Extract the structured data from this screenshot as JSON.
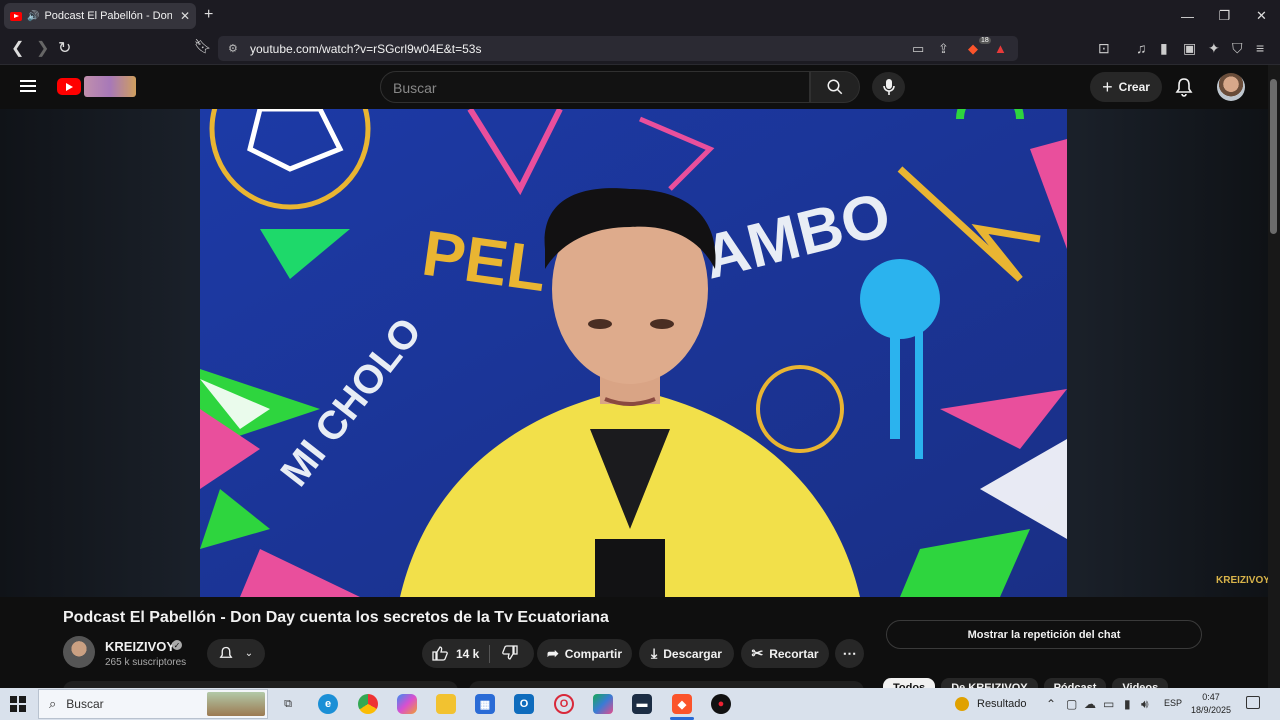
{
  "browser": {
    "tab_title": "Podcast El Pabellón - Don Day",
    "tab_close": "✕",
    "new_tab": "+",
    "url": "youtube.com/watch?v=rSGcrl9w04E&t=53s",
    "shield_count": "18"
  },
  "youtube": {
    "search_placeholder": "Buscar",
    "create_label": "Crear",
    "video": {
      "title": "Podcast El Pabellón - Don Day cuenta los secretos de la Tv Ecuatoriana",
      "watermark": "KREIZIVOY",
      "wall_texts": [
        "PEL",
        "AMBO",
        "MI CHOLO"
      ]
    },
    "channel": {
      "name": "KREIZIVOY",
      "subscribers": "265 k suscriptores"
    },
    "actions": {
      "likes": "14 k",
      "share": "Compartir",
      "download": "Descargar",
      "clip": "Recortar",
      "more": "⋯"
    },
    "chat_replay": "Mostrar la repetición del chat",
    "chips": [
      "Todos",
      "De KREIZIVOY",
      "Pódcast",
      "Videos"
    ]
  },
  "taskbar": {
    "search": "Buscar",
    "weather": "Resultado",
    "language": "ESP",
    "time": "0:47",
    "date": "18/9/2025"
  },
  "colors": {
    "youtube_red": "#ff0000",
    "background": "#0f0f0f",
    "video_wall": "#1f3ea9",
    "shirt": "#f2e04a"
  }
}
